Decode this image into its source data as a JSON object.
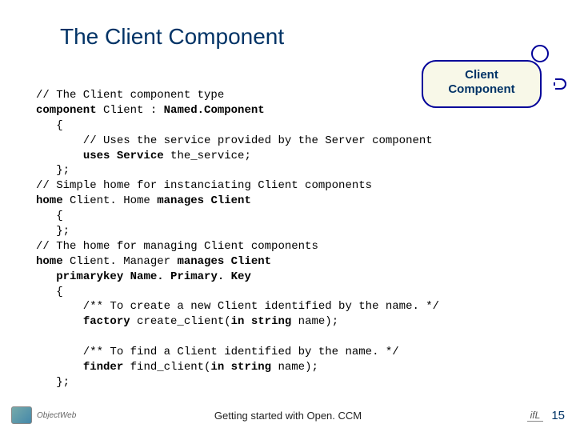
{
  "title": "The Client Component",
  "diagram": {
    "box_line1": "Client",
    "box_line2": "Component"
  },
  "code": {
    "l1": "// The Client component type",
    "l2a": "component",
    "l2b": " Client : ",
    "l2c": "Named.Component",
    "l3": "   {",
    "l4": "       // Uses the service provided by the Server component",
    "l5a": "       ",
    "l5b": "uses",
    "l5c": " ",
    "l5d": "Service",
    "l5e": " the_service;",
    "l6": "   };",
    "l7": "// Simple home for instanciating Client components",
    "l8a": "home",
    "l8b": " Client. Home ",
    "l8c": "manages",
    "l8d": " Client",
    "l9": "   {",
    "l10": "   };",
    "l11": "// The home for managing Client components",
    "l12a": "home",
    "l12b": " Client. Manager ",
    "l12c": "manages",
    "l12d": " Client",
    "l13a": "   ",
    "l13b": "primarykey",
    "l13c": " Name. Primary. Key",
    "l14": "   {",
    "l15": "       /** To create a new Client identified by the name. */",
    "l16a": "       ",
    "l16b": "factory",
    "l16c": " create_client(",
    "l16d": "in string",
    "l16e": " name);",
    "l17": "",
    "l18": "       /** To find a Client identified by the name. */",
    "l19a": "       ",
    "l19b": "finder",
    "l19c": " find_client(",
    "l19d": "in string",
    "l19e": " name);",
    "l20": "   };"
  },
  "footer": {
    "center": "Getting started with Open. CCM",
    "ifl": "ifL",
    "page": "15",
    "ow": "ObjectWeb"
  }
}
